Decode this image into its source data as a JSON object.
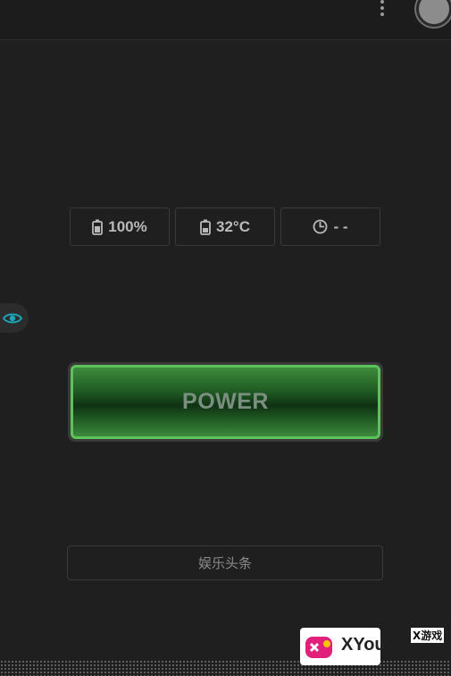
{
  "topbar": {
    "menu_icon": "more-vertical-icon",
    "profile_icon": "profile-circle-icon"
  },
  "stats": [
    {
      "icon": "battery-icon",
      "value": "100%"
    },
    {
      "icon": "battery-temperature-icon",
      "value": "32°C"
    },
    {
      "icon": "timer-icon",
      "value": "- -"
    }
  ],
  "side_tab": {
    "icon": "eye-icon",
    "color": "#1aa6b8"
  },
  "power": {
    "label": "POWER",
    "accent": "#5cc25a"
  },
  "news": {
    "label": "娱乐头条"
  },
  "watermark": {
    "brand": "XYou",
    "tag": "X游戏"
  }
}
